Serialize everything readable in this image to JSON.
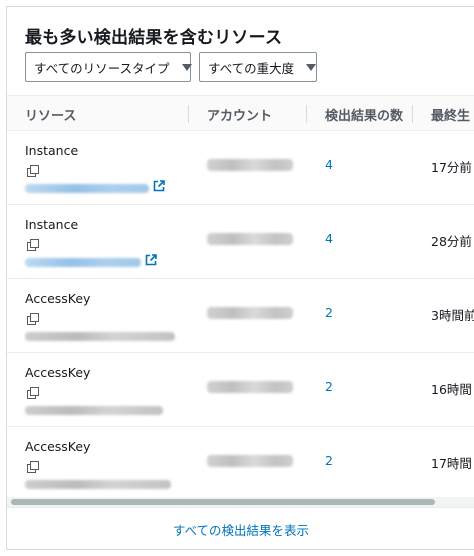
{
  "panel": {
    "title": "最も多い検出結果を含むリソース",
    "filters": {
      "resource_type": "すべてのリソースタイプ",
      "severity": "すべての重大度"
    }
  },
  "table": {
    "columns": [
      "リソース",
      "アカウント",
      "検出結果の数",
      "最終生"
    ],
    "rows": [
      {
        "type": "Instance",
        "count": "4",
        "time": "17分前"
      },
      {
        "type": "Instance",
        "count": "4",
        "time": "28分前"
      },
      {
        "type": "AccessKey",
        "count": "2",
        "time": "3時間前"
      },
      {
        "type": "AccessKey",
        "count": "2",
        "time": "16時間"
      },
      {
        "type": "AccessKey",
        "count": "2",
        "time": "17時間"
      }
    ]
  },
  "footer": {
    "link": "すべての検出結果を表示"
  },
  "icons": {
    "copy": "copy-icon",
    "external_link": "external-link-icon",
    "dropdown": "caret-down-icon"
  },
  "colors": {
    "link": "#0073bb",
    "header_text": "#545b64",
    "border": "#eaeded"
  }
}
